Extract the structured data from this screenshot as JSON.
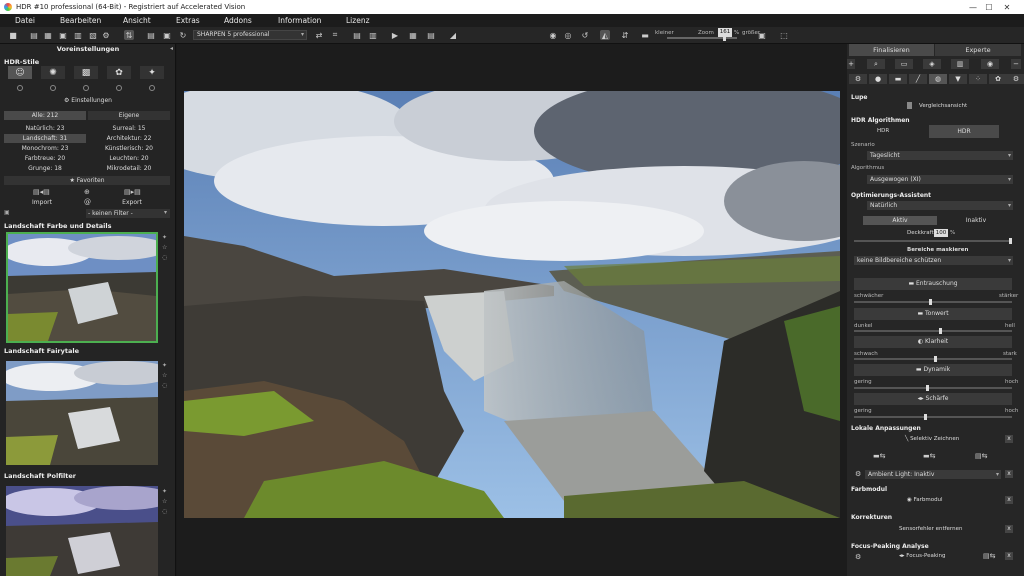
{
  "titlebar": {
    "title": "HDR #10 professional (64-Bit) - Registriert auf Accelerated Vision"
  },
  "menu": [
    "Datei",
    "Bearbeiten",
    "Ansicht",
    "Extras",
    "Addons",
    "Information",
    "Lizenz"
  ],
  "toolbar": {
    "preset": "SHARPEN 5 professional",
    "zoom_label": "Zoom",
    "zoom_value": "161",
    "zoom_unit": "%",
    "smaller_label": "kleiner",
    "larger_label": "größer"
  },
  "left": {
    "header": "Voreinstellungen",
    "hdr_styles_title": "HDR-Stile",
    "settings_label": "Einstellungen",
    "tab_all": "Alle: 212",
    "tab_own": "Eigene",
    "categories": [
      [
        "Natürlich: 23",
        "Surreal: 15"
      ],
      [
        "Landschaft: 31",
        "Architektur: 22"
      ],
      [
        "Monochrom: 23",
        "Künstlerisch: 20"
      ],
      [
        "Farbtreue: 20",
        "Leuchten: 20"
      ],
      [
        "Grunge: 18",
        "Mikrodetail: 20"
      ]
    ],
    "favorites": "★ Favoriten",
    "import": "Import",
    "export": "Export",
    "filter": "- keinen Filter -",
    "presets": [
      "Landschaft Farbe und Details",
      "Landschaft Fairytale",
      "Landschaft Polfilter"
    ]
  },
  "right": {
    "tab_finalize": "Finalisieren",
    "tab_expert": "Experte",
    "lupe": "Lupe",
    "compare": "Vergleichsansicht",
    "algorithms": "HDR Algorithmen",
    "algo_btn1": "HDR",
    "algo_btn2": "HDR",
    "scenario_label": "Szenario",
    "scenario_value": "Tageslicht",
    "algorithm_label": "Algorithmus",
    "algorithm_value": "Ausgewogen (XI)",
    "opt_assistant": "Optimierungs-Assistent",
    "opt_value": "Natürlich",
    "active": "Aktiv",
    "inactive": "Inaktiv",
    "opacity_label": "Deckkraft",
    "opacity_value": "100",
    "opacity_unit": "%",
    "mask_title": "Bereiche maskieren",
    "mask_value": "keine Bildbereiche schützen",
    "denoise": "Entrauschung",
    "weaker": "schwächer",
    "stronger": "stärker",
    "tonwert": "Tonwert",
    "dark": "dunkel",
    "bright": "hell",
    "clarity": "Klarheit",
    "weak": "schwach",
    "strong": "stark",
    "dynamic": "Dynamik",
    "low": "gering",
    "high": "hoch",
    "sharpness": "Schärfe",
    "local": "Lokale Anpassungen",
    "selective": "Selektiv Zeichnen",
    "ambient": "Ambient Light: Inaktiv",
    "farbmodul_title": "Farbmodul",
    "farbmodul": "Farbmodul",
    "korrekturen": "Korrekturen",
    "sensor": "Sensorfehler entfernen",
    "focus_title": "Focus-Peaking Analyse",
    "focus": "Focus-Peaking"
  }
}
